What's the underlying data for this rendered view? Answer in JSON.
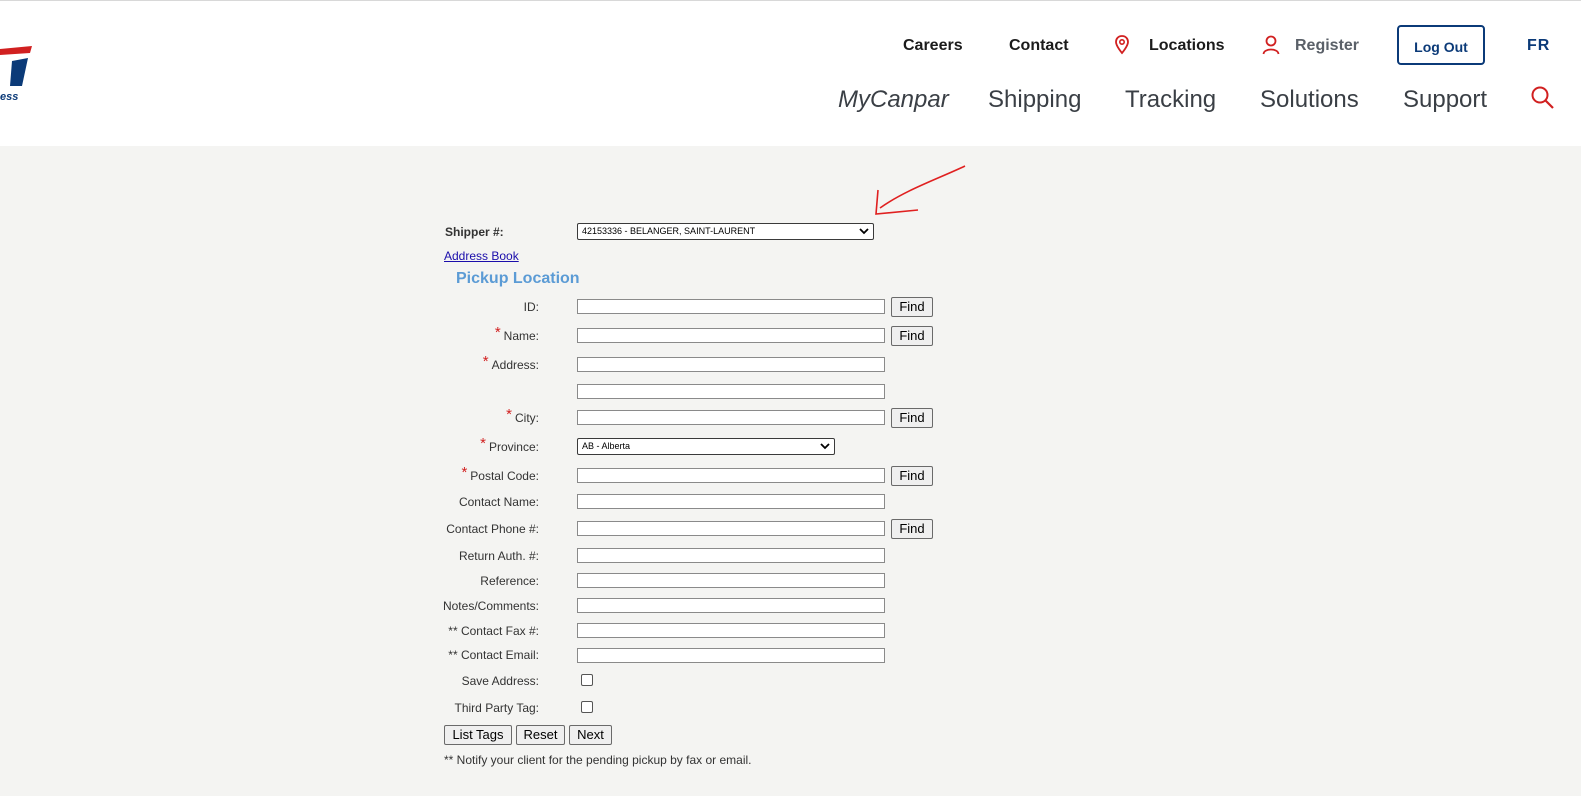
{
  "header": {
    "utility": {
      "careers": "Careers",
      "contact": "Contact",
      "locations": "Locations",
      "register": "Register",
      "logout": "Log Out",
      "lang": "FR"
    },
    "nav": [
      "MyCanpar",
      "Shipping",
      "Tracking",
      "Solutions",
      "Support"
    ],
    "logo_text": "ess",
    "colors": {
      "brand_blue": "#0b3a78",
      "brand_red": "#d12020"
    }
  },
  "form": {
    "shipper_label": "Shipper #:",
    "shipper_value": "42153336 - BELANGER, SAINT-LAURENT",
    "address_book": "Address Book",
    "section_title": "Pickup Location",
    "fields": {
      "id": "ID:",
      "name": "Name:",
      "address": "Address:",
      "city": "City:",
      "province": "Province:",
      "postal": "Postal Code:",
      "contact_name": "Contact Name:",
      "contact_phone": "Contact Phone #:",
      "return_auth": "Return Auth. #:",
      "reference": "Reference:",
      "notes": "Notes/Comments:",
      "contact_fax": "** Contact Fax #:",
      "contact_email": "** Contact Email:",
      "save_address": "Save Address:",
      "third_party": "Third Party Tag:"
    },
    "required_mark": "*",
    "province_value": "AB - Alberta",
    "find": "Find",
    "buttons": {
      "list_tags": "List Tags",
      "reset": "Reset",
      "next": "Next"
    },
    "footnote": "** Notify your client for the pending pickup by fax or email."
  }
}
